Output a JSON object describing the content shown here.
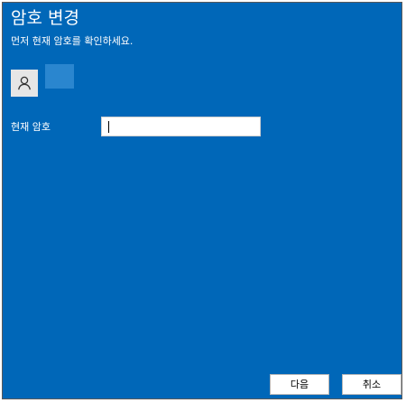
{
  "dialog": {
    "title": "암호 변경",
    "subtitle": "먼저 현재 암호를 확인하세요.",
    "background_color": "#0067b8"
  },
  "account": {
    "avatar_icon": "user-icon",
    "username": ""
  },
  "form": {
    "current_password_label": "현재 암호",
    "current_password_value": "",
    "current_password_placeholder": ""
  },
  "buttons": {
    "next_label": "다음",
    "cancel_label": "취소"
  }
}
